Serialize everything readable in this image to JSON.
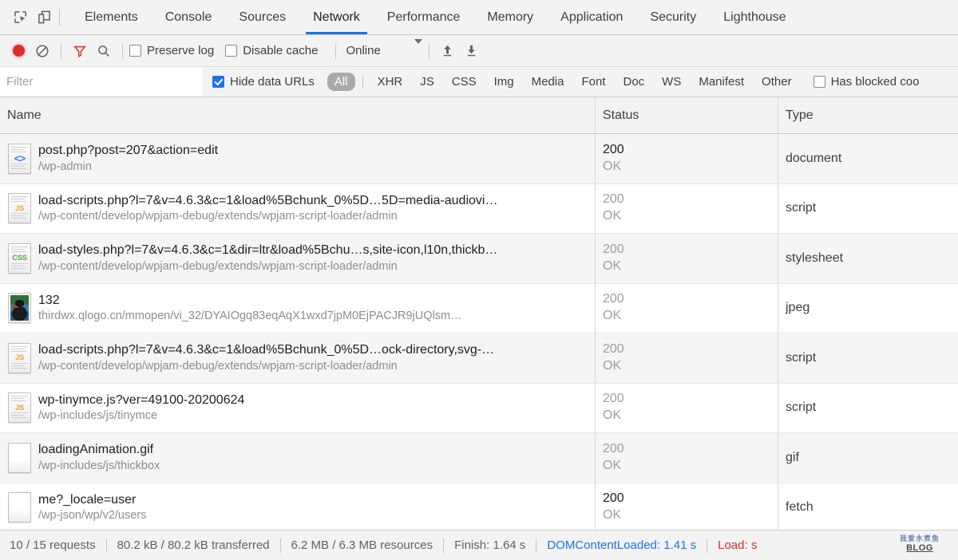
{
  "tabbar": {
    "icons": [
      {
        "name": "inspect-element-icon",
        "title": "Inspect element"
      },
      {
        "name": "device-toolbar-icon",
        "title": "Toggle device toolbar"
      }
    ],
    "tabs": [
      {
        "label": "Elements",
        "active": false
      },
      {
        "label": "Console",
        "active": false
      },
      {
        "label": "Sources",
        "active": false
      },
      {
        "label": "Network",
        "active": true
      },
      {
        "label": "Performance",
        "active": false
      },
      {
        "label": "Memory",
        "active": false
      },
      {
        "label": "Application",
        "active": false
      },
      {
        "label": "Security",
        "active": false
      },
      {
        "label": "Lighthouse",
        "active": false
      }
    ],
    "active_tab": "Network",
    "accent_color": "#1a73e8"
  },
  "toolbar": {
    "record_title": "Stop recording network log",
    "record_color": "#dd2c2c",
    "clear_title": "Clear",
    "filter_title": "Filter",
    "filter_color": "#d93025",
    "search_title": "Search",
    "preserve_log_label": "Preserve log",
    "preserve_log_checked": false,
    "disable_cache_label": "Disable cache",
    "disable_cache_checked": false,
    "throttle_value": "Online",
    "import_title": "Import HAR file",
    "export_title": "Export HAR file"
  },
  "filterbar": {
    "filter_placeholder": "Filter",
    "filter_value": "",
    "hide_data_urls_label": "Hide data URLs",
    "hide_data_urls_checked": true,
    "types": [
      {
        "label": "All",
        "active": true
      },
      {
        "label": "XHR",
        "active": false
      },
      {
        "label": "JS",
        "active": false
      },
      {
        "label": "CSS",
        "active": false
      },
      {
        "label": "Img",
        "active": false
      },
      {
        "label": "Media",
        "active": false
      },
      {
        "label": "Font",
        "active": false
      },
      {
        "label": "Doc",
        "active": false
      },
      {
        "label": "WS",
        "active": false
      },
      {
        "label": "Manifest",
        "active": false
      },
      {
        "label": "Other",
        "active": false
      }
    ],
    "has_blocked_cookies_label": "Has blocked coo",
    "has_blocked_cookies_checked": false
  },
  "table": {
    "columns": [
      {
        "label": "Name"
      },
      {
        "label": "Status"
      },
      {
        "label": "Type"
      }
    ],
    "rows": [
      {
        "icon": "document-file-icon",
        "name": "post.php?post=207&action=edit",
        "path": "/wp-admin",
        "status_code": "200",
        "status_text": "OK",
        "type": "document",
        "strong": true
      },
      {
        "icon": "js-file-icon",
        "name": "load-scripts.php?l=7&v=4.6.3&c=1&load%5Bchunk_0%5D…5D=media-audiovi…",
        "path": "/wp-content/develop/wpjam-debug/extends/wpjam-script-loader/admin",
        "status_code": "200",
        "status_text": "OK",
        "type": "script",
        "strong": false
      },
      {
        "icon": "css-file-icon",
        "name": "load-styles.php?l=7&v=4.6.3&c=1&dir=ltr&load%5Bchu…s,site-icon,l10n,thickb…",
        "path": "/wp-content/develop/wpjam-debug/extends/wpjam-script-loader/admin",
        "status_code": "200",
        "status_text": "OK",
        "type": "stylesheet",
        "strong": false
      },
      {
        "icon": "image-thumbnail-icon",
        "name": "132",
        "path": "thirdwx.qlogo.cn/mmopen/vi_32/DYAIOgq83eqAqX1wxd7jpM0EjPACJR9jUQlsm…",
        "status_code": "200",
        "status_text": "OK",
        "type": "jpeg",
        "strong": false
      },
      {
        "icon": "js-file-icon",
        "name": "load-scripts.php?l=7&v=4.6.3&c=1&load%5Bchunk_0%5D…ock-directory,svg-…",
        "path": "/wp-content/develop/wpjam-debug/extends/wpjam-script-loader/admin",
        "status_code": "200",
        "status_text": "OK",
        "type": "script",
        "strong": false
      },
      {
        "icon": "js-file-icon",
        "name": "wp-tinymce.js?ver=49100-20200624",
        "path": "/wp-includes/js/tinymce",
        "status_code": "200",
        "status_text": "OK",
        "type": "script",
        "strong": false
      },
      {
        "icon": "plain-file-icon",
        "name": "loadingAnimation.gif",
        "path": "/wp-includes/js/thickbox",
        "status_code": "200",
        "status_text": "OK",
        "type": "gif",
        "strong": false
      },
      {
        "icon": "plain-file-icon",
        "name": "me?_locale=user",
        "path": "/wp-json/wp/v2/users",
        "status_code": "200",
        "status_text": "OK",
        "type": "fetch",
        "strong": true
      }
    ]
  },
  "statusbar": {
    "requests": "10 / 15 requests",
    "transferred": "80.2 kB / 80.2 kB transferred",
    "resources": "6.2 MB / 6.3 MB resources",
    "finish": "Finish: 1.64 s",
    "dom_content_loaded": "DOMContentLoaded: 1.41 s",
    "load": "Load:",
    "load_unit": "s",
    "dcl_color": "#1a73e8",
    "load_color": "#d93025",
    "watermark_top": "我爱水煮鱼",
    "watermark_bottom": "BLOG"
  }
}
